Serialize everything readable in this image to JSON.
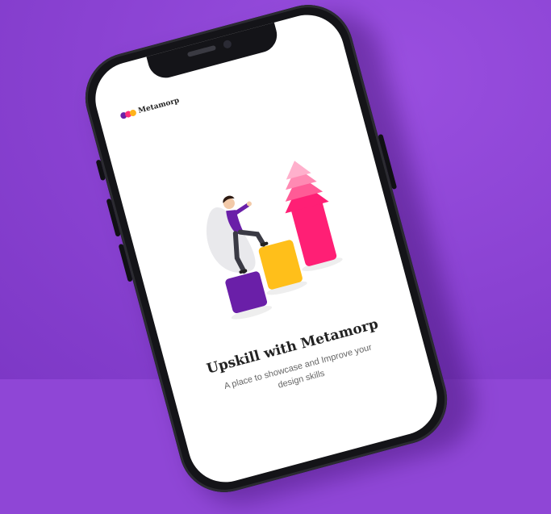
{
  "brand": {
    "name": "Metamorp",
    "dot_colors": [
      "#6a1fa8",
      "#ff2d78",
      "#ffb21a"
    ]
  },
  "onboarding": {
    "title": "Upskill with Metamorp",
    "subtitle": "A place to showcase and Improve your design skills"
  },
  "colors": {
    "background": "#8f46d6",
    "step_purple": "#6a1fa8",
    "step_yellow": "#ffbf1a",
    "arrow_pink": "#ff1f75"
  },
  "illustration": {
    "icon": "person-climbing-steps-arrow-illustration"
  }
}
